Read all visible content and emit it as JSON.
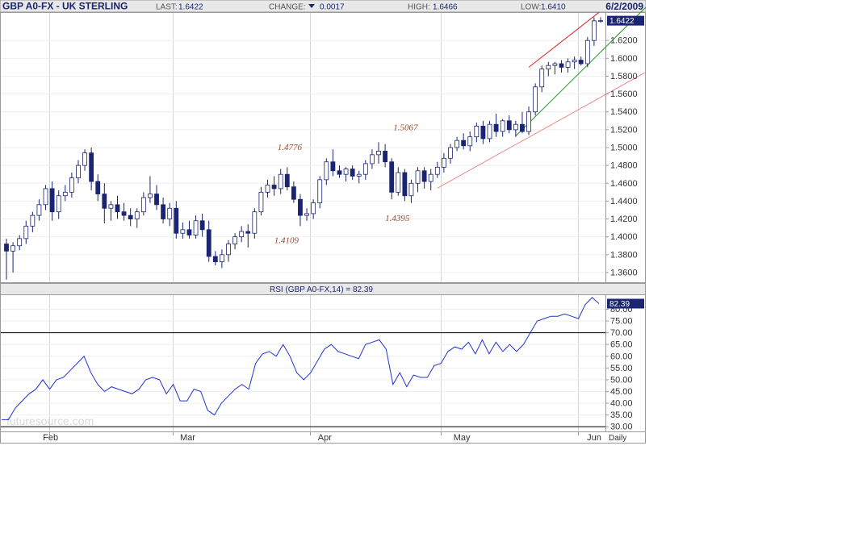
{
  "header": {
    "symbol": "GBP A0-FX - UK STERLING",
    "last_label": "LAST:",
    "last_value": "1.6422",
    "change_label": "CHANGE:",
    "change_value": "0.0017",
    "high_label": "HIGH:",
    "high_value": "1.6466",
    "low_label": "LOW:",
    "low_value": "1.6410",
    "date": "6/2/2009"
  },
  "rsi_title": "RSI (GBP A0-FX,14) = 82.39",
  "price_tag": "1.6422",
  "rsi_tag": "82.39",
  "period_label": "Daily",
  "watermark": "futuresource.com",
  "colors": {
    "candle_down": "#1a2470",
    "candle_up": "#ffffff",
    "rsi_line": "#2233cc",
    "trend_red": "#dd2222",
    "trend_green": "#229922",
    "trend_pink": "#ee8888",
    "tag_bg": "#1a2470"
  },
  "chart_data": [
    {
      "type": "candlestick",
      "ylim": [
        1.35,
        1.65
      ],
      "yticks": [
        "1.3600",
        "1.3800",
        "1.4000",
        "1.4200",
        "1.4400",
        "1.4600",
        "1.4800",
        "1.5000",
        "1.5200",
        "1.5400",
        "1.5600",
        "1.5800",
        "1.6000",
        "1.6200"
      ],
      "xticks": [
        "Feb",
        "Mar",
        "Apr",
        "May",
        "Jun"
      ],
      "annotations": [
        {
          "text": "1.4776",
          "value": 1.4776
        },
        {
          "text": "1.5067",
          "value": 1.5067
        },
        {
          "text": "1.4109",
          "value": 1.4109
        },
        {
          "text": "1.4395",
          "value": 1.4395
        }
      ],
      "ohlc": [
        [
          1.392,
          1.398,
          1.352,
          1.384
        ],
        [
          1.384,
          1.394,
          1.36,
          1.39
        ],
        [
          1.39,
          1.402,
          1.385,
          1.398
        ],
        [
          1.398,
          1.418,
          1.392,
          1.412
        ],
        [
          1.412,
          1.428,
          1.405,
          1.424
        ],
        [
          1.424,
          1.442,
          1.418,
          1.436
        ],
        [
          1.436,
          1.458,
          1.43,
          1.454
        ],
        [
          1.454,
          1.462,
          1.418,
          1.428
        ],
        [
          1.428,
          1.452,
          1.42,
          1.446
        ],
        [
          1.446,
          1.458,
          1.44,
          1.45
        ],
        [
          1.45,
          1.472,
          1.444,
          1.466
        ],
        [
          1.466,
          1.486,
          1.46,
          1.48
        ],
        [
          1.48,
          1.498,
          1.474,
          1.494
        ],
        [
          1.494,
          1.5,
          1.452,
          1.462
        ],
        [
          1.462,
          1.47,
          1.44,
          1.448
        ],
        [
          1.448,
          1.46,
          1.415,
          1.432
        ],
        [
          1.432,
          1.44,
          1.418,
          1.436
        ],
        [
          1.436,
          1.446,
          1.42,
          1.428
        ],
        [
          1.428,
          1.438,
          1.418,
          1.424
        ],
        [
          1.424,
          1.432,
          1.412,
          1.42
        ],
        [
          1.42,
          1.432,
          1.41,
          1.428
        ],
        [
          1.428,
          1.45,
          1.424,
          1.444
        ],
        [
          1.444,
          1.468,
          1.438,
          1.448
        ],
        [
          1.448,
          1.458,
          1.43,
          1.436
        ],
        [
          1.436,
          1.444,
          1.415,
          1.42
        ],
        [
          1.42,
          1.438,
          1.412,
          1.432
        ],
        [
          1.432,
          1.44,
          1.398,
          1.404
        ],
        [
          1.404,
          1.416,
          1.398,
          1.408
        ],
        [
          1.408,
          1.418,
          1.398,
          1.402
        ],
        [
          1.402,
          1.424,
          1.398,
          1.418
        ],
        [
          1.418,
          1.426,
          1.4,
          1.408
        ],
        [
          1.408,
          1.418,
          1.372,
          1.378
        ],
        [
          1.378,
          1.384,
          1.368,
          1.372
        ],
        [
          1.372,
          1.386,
          1.365,
          1.38
        ],
        [
          1.38,
          1.396,
          1.372,
          1.392
        ],
        [
          1.392,
          1.404,
          1.386,
          1.4
        ],
        [
          1.4,
          1.412,
          1.394,
          1.406
        ],
        [
          1.406,
          1.414,
          1.388,
          1.404
        ],
        [
          1.404,
          1.432,
          1.398,
          1.428
        ],
        [
          1.428,
          1.456,
          1.424,
          1.45
        ],
        [
          1.45,
          1.464,
          1.444,
          1.458
        ],
        [
          1.458,
          1.468,
          1.446,
          1.454
        ],
        [
          1.454,
          1.476,
          1.448,
          1.47
        ],
        [
          1.47,
          1.478,
          1.452,
          1.456
        ],
        [
          1.456,
          1.462,
          1.438,
          1.442
        ],
        [
          1.442,
          1.448,
          1.412,
          1.424
        ],
        [
          1.424,
          1.432,
          1.418,
          1.426
        ],
        [
          1.426,
          1.442,
          1.42,
          1.438
        ],
        [
          1.438,
          1.468,
          1.432,
          1.464
        ],
        [
          1.464,
          1.488,
          1.458,
          1.484
        ],
        [
          1.484,
          1.498,
          1.468,
          1.474
        ],
        [
          1.474,
          1.48,
          1.466,
          1.47
        ],
        [
          1.47,
          1.478,
          1.462,
          1.476
        ],
        [
          1.476,
          1.48,
          1.464,
          1.468
        ],
        [
          1.468,
          1.474,
          1.46,
          1.47
        ],
        [
          1.47,
          1.486,
          1.464,
          1.482
        ],
        [
          1.482,
          1.498,
          1.476,
          1.492
        ],
        [
          1.492,
          1.506,
          1.482,
          1.496
        ],
        [
          1.496,
          1.504,
          1.478,
          1.484
        ],
        [
          1.484,
          1.488,
          1.442,
          1.45
        ],
        [
          1.45,
          1.478,
          1.446,
          1.472
        ],
        [
          1.472,
          1.476,
          1.44,
          1.446
        ],
        [
          1.446,
          1.464,
          1.438,
          1.46
        ],
        [
          1.46,
          1.478,
          1.45,
          1.474
        ],
        [
          1.474,
          1.478,
          1.454,
          1.462
        ],
        [
          1.462,
          1.476,
          1.452,
          1.47
        ],
        [
          1.47,
          1.484,
          1.466,
          1.478
        ],
        [
          1.478,
          1.494,
          1.472,
          1.488
        ],
        [
          1.488,
          1.504,
          1.482,
          1.5
        ],
        [
          1.5,
          1.512,
          1.496,
          1.508
        ],
        [
          1.508,
          1.516,
          1.498,
          1.502
        ],
        [
          1.502,
          1.518,
          1.496,
          1.512
        ],
        [
          1.512,
          1.528,
          1.506,
          1.524
        ],
        [
          1.524,
          1.53,
          1.504,
          1.51
        ],
        [
          1.51,
          1.53,
          1.506,
          1.526
        ],
        [
          1.526,
          1.538,
          1.512,
          1.518
        ],
        [
          1.518,
          1.532,
          1.512,
          1.53
        ],
        [
          1.53,
          1.536,
          1.516,
          1.52
        ],
        [
          1.52,
          1.53,
          1.512,
          1.526
        ],
        [
          1.526,
          1.54,
          1.516,
          1.518
        ],
        [
          1.518,
          1.546,
          1.514,
          1.54
        ],
        [
          1.54,
          1.572,
          1.536,
          1.568
        ],
        [
          1.568,
          1.592,
          1.562,
          1.588
        ],
        [
          1.588,
          1.596,
          1.58,
          1.592
        ],
        [
          1.592,
          1.596,
          1.582,
          1.594
        ],
        [
          1.594,
          1.598,
          1.584,
          1.59
        ],
        [
          1.59,
          1.6,
          1.584,
          1.596
        ],
        [
          1.596,
          1.602,
          1.588,
          1.598
        ],
        [
          1.598,
          1.602,
          1.592,
          1.594
        ],
        [
          1.594,
          1.624,
          1.59,
          1.62
        ],
        [
          1.62,
          1.646,
          1.614,
          1.642
        ],
        [
          1.642,
          1.646,
          1.64,
          1.6422
        ]
      ]
    },
    {
      "type": "line",
      "name": "RSI (GBP A0-FX,14)",
      "ylim": [
        28,
        86
      ],
      "yticks": [
        "30.00",
        "35.00",
        "40.00",
        "45.00",
        "50.00",
        "55.00",
        "60.00",
        "65.00",
        "70.00",
        "75.00",
        "80.00"
      ],
      "reference_lines": [
        70,
        30
      ],
      "values": [
        33,
        33,
        38,
        41,
        44,
        46,
        50,
        46,
        50,
        51,
        54,
        57,
        60,
        53,
        48,
        45,
        47,
        46,
        45,
        44,
        46,
        50,
        51,
        50,
        44,
        48,
        41,
        41,
        46,
        45,
        37,
        35,
        40,
        43,
        46,
        48,
        46,
        57,
        61,
        62,
        60,
        65,
        60,
        53,
        50,
        53,
        58,
        63,
        65,
        62,
        61,
        60,
        59,
        65,
        66,
        67,
        63,
        48,
        53,
        47,
        52,
        51,
        51,
        56,
        57,
        62,
        64,
        63,
        66,
        61,
        67,
        61,
        66,
        62,
        65,
        62,
        65,
        70,
        75,
        76,
        77,
        77,
        78,
        77,
        76,
        82,
        85,
        82.39
      ]
    }
  ]
}
